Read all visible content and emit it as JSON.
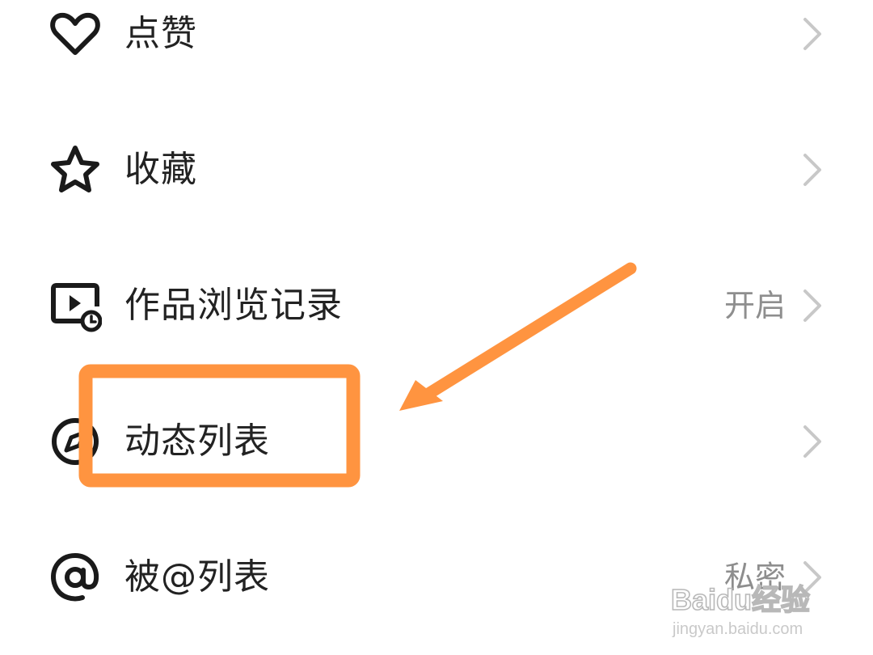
{
  "rows": [
    {
      "label": "点赞",
      "value": "",
      "icon": "heart-icon"
    },
    {
      "label": "收藏",
      "value": "",
      "icon": "star-icon"
    },
    {
      "label": "作品浏览记录",
      "value": "开启",
      "icon": "video-history-icon"
    },
    {
      "label": "动态列表",
      "value": "",
      "icon": "compass-icon"
    },
    {
      "label": "被@列表",
      "value": "私密",
      "icon": "at-sign-icon"
    }
  ],
  "annotation": {
    "highlight_color": "#ff9440",
    "highlighted_row": "动态列表"
  },
  "watermark": {
    "brand": "Baidu经验",
    "url": "jingyan.baidu.com"
  },
  "colors": {
    "label": "#222222",
    "value": "#8e8e8e",
    "chevron": "#c8c8c8",
    "icon": "#1a1a1a"
  }
}
